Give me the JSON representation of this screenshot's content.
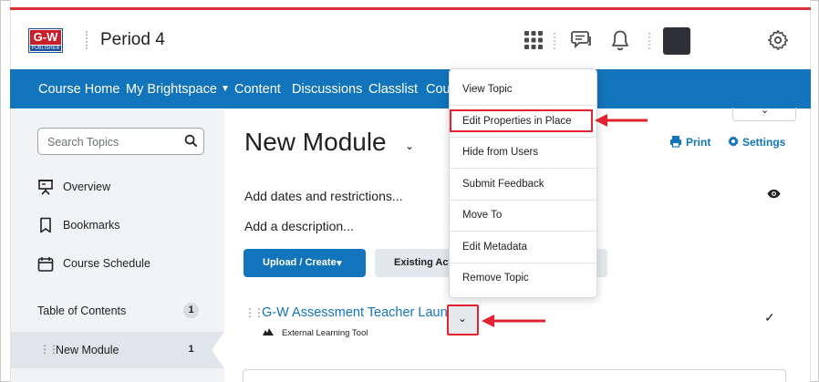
{
  "header": {
    "logo_top": "G-W",
    "logo_bottom": "PUBLISHER",
    "course_title": "Period 4"
  },
  "navbar": {
    "items": [
      {
        "label": "Course Home"
      },
      {
        "label": "My Brightspace"
      },
      {
        "label": "Content"
      },
      {
        "label": "Discussions"
      },
      {
        "label": "Classlist"
      },
      {
        "label": "Cou"
      }
    ]
  },
  "sidebar": {
    "search_placeholder": "Search Topics",
    "items": [
      {
        "label": "Overview",
        "icon": "presentation-icon"
      },
      {
        "label": "Bookmarks",
        "icon": "bookmark-icon"
      },
      {
        "label": "Course Schedule",
        "icon": "calendar-icon"
      }
    ],
    "toc_label": "Table of Contents",
    "toc_count": "1",
    "module_label": "New Module",
    "module_count": "1"
  },
  "main": {
    "module_title": "New Module",
    "print_label": "Print",
    "settings_label": "Settings",
    "dates_link": "Add dates and restrictions...",
    "desc_link": "Add a description...",
    "upload_button": "Upload / Create",
    "existing_button": "Existing Activ",
    "topic_title": "G-W Assessment Teacher Launch",
    "topic_type": "External Learning Tool"
  },
  "context_menu": {
    "items": [
      {
        "label": "View Topic"
      },
      {
        "label": "Edit Properties in Place"
      },
      {
        "label": "Hide from Users"
      },
      {
        "label": "Submit Feedback"
      },
      {
        "label": "Move To"
      },
      {
        "label": "Edit Metadata"
      },
      {
        "label": "Remove Topic"
      }
    ],
    "highlighted_index": 1
  },
  "colors": {
    "brand_blue": "#1274bb",
    "annotation_red": "#e2232f",
    "sidebar_bg": "#f1f3f6"
  }
}
